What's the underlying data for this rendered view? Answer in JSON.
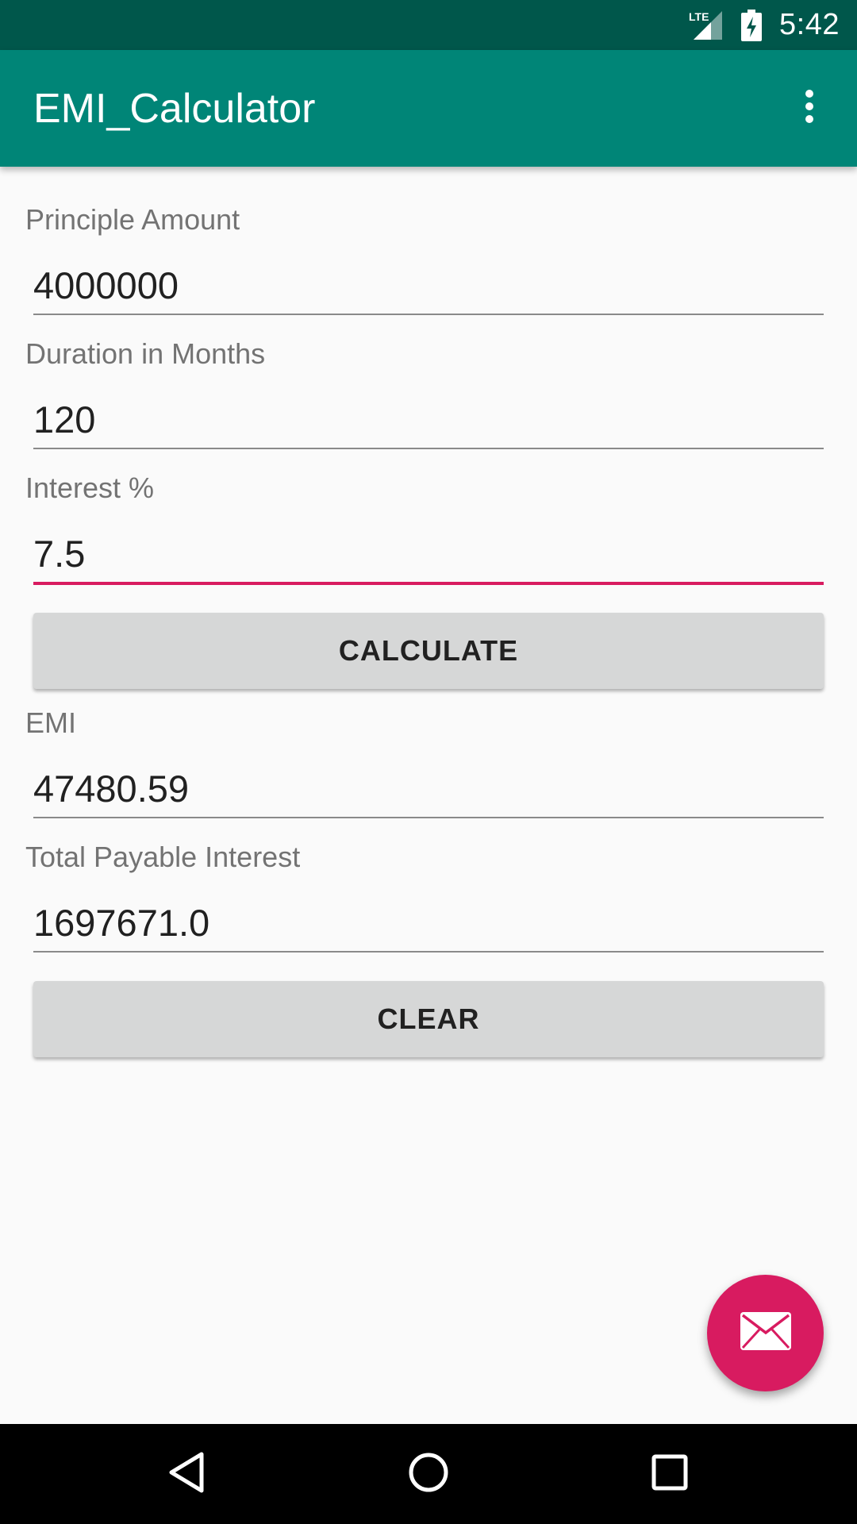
{
  "status_bar": {
    "network": "LTE",
    "time": "5:42",
    "icons": [
      "lte-signal-icon",
      "battery-charging-icon"
    ]
  },
  "app_bar": {
    "title": "EMI_Calculator",
    "overflow_icon": "more-vert-icon"
  },
  "form": {
    "principle": {
      "label": "Principle Amount",
      "value": "4000000"
    },
    "duration": {
      "label": "Duration in Months",
      "value": "120"
    },
    "interest": {
      "label": "Interest %",
      "value": "7.5"
    },
    "calculate_label": "CALCULATE",
    "emi": {
      "label": "EMI",
      "value": "47480.59"
    },
    "total_interest": {
      "label": "Total Payable Interest",
      "value": "1697671.0"
    },
    "clear_label": "CLEAR"
  },
  "fab": {
    "icon": "email-icon"
  },
  "nav_bar": {
    "icons": [
      "back-icon",
      "home-icon",
      "recents-icon"
    ]
  },
  "colors": {
    "status_bar": "#00574b",
    "app_bar": "#008577",
    "accent": "#d81b60",
    "button": "#d6d7d7"
  }
}
